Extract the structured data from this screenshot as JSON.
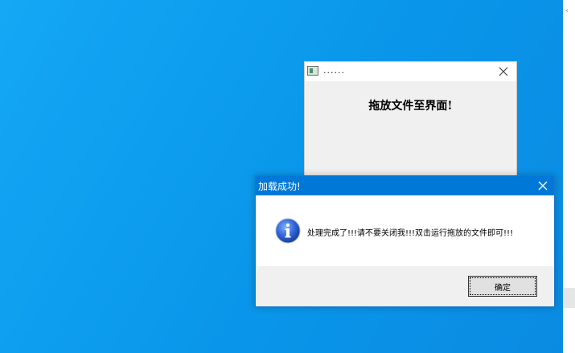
{
  "desktop": {
    "background_color": "#0b97eb"
  },
  "background_window": {
    "title": "......",
    "heading": "拖放文件至界面!",
    "icons": {
      "app": "app-window-icon",
      "close": "close-icon"
    }
  },
  "message_box": {
    "title": "加载成功!",
    "message": "处理完成了!!!请不要关闭我!!!双击运行拖放的文件即可!!!",
    "ok_label": "确定",
    "icons": {
      "info": "info-icon",
      "close": "close-icon"
    },
    "titlebar_color": "#0078d7"
  }
}
